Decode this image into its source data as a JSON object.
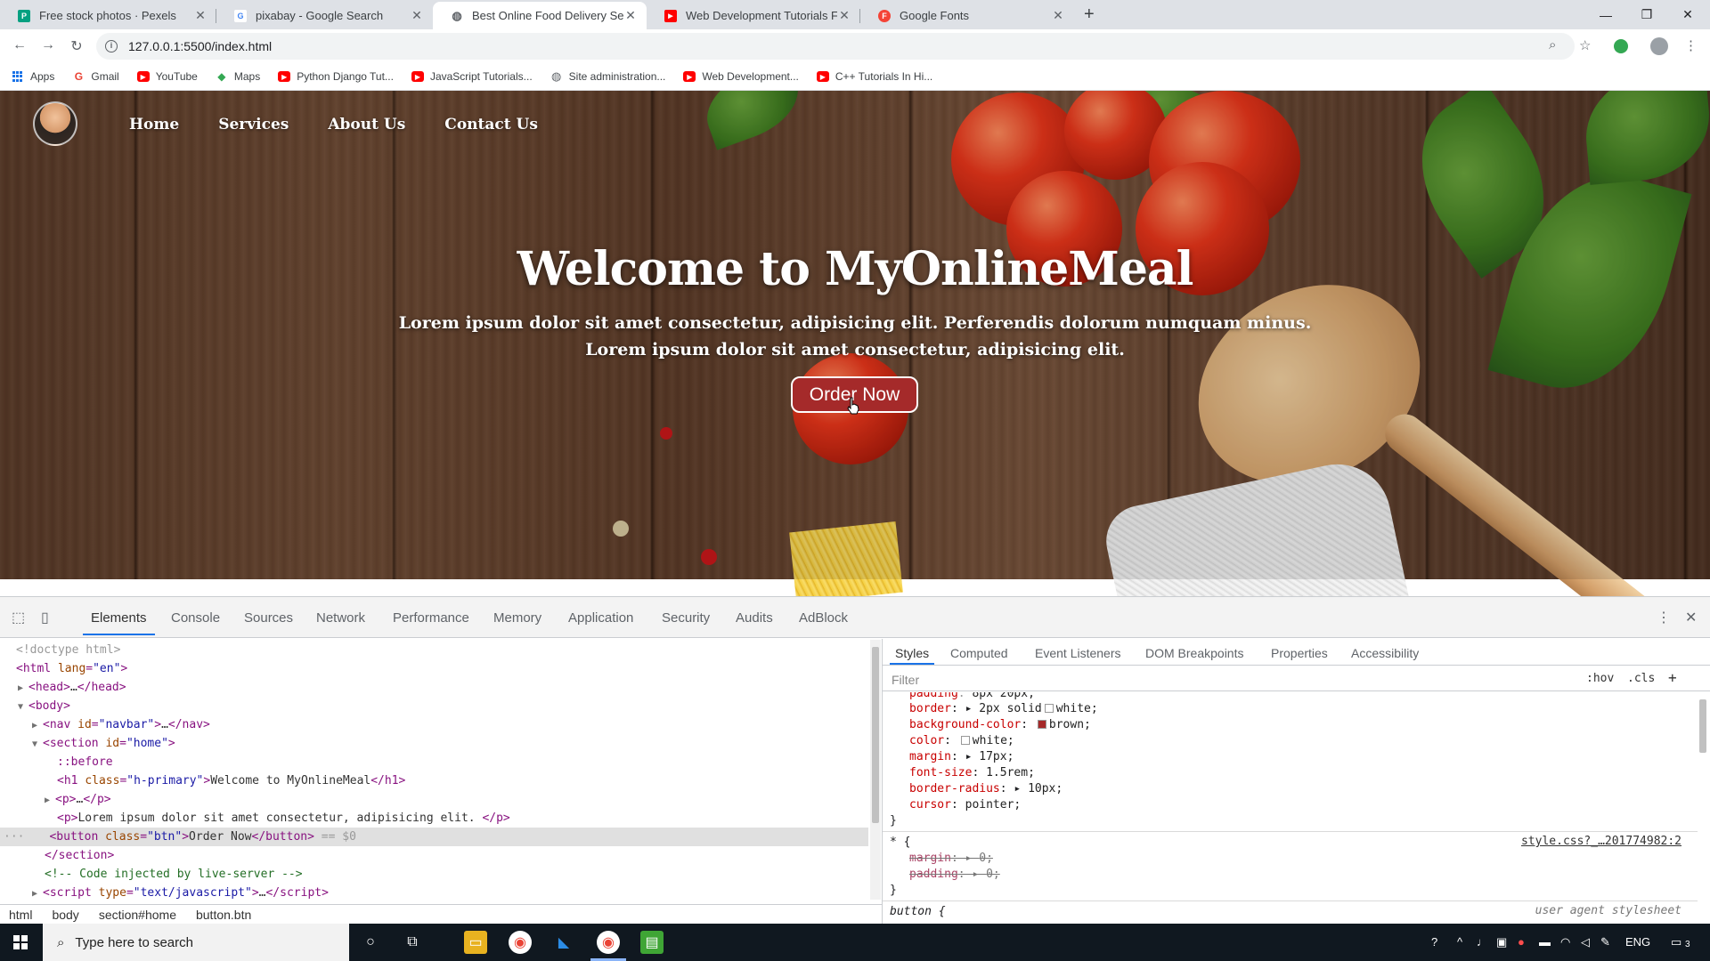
{
  "browser": {
    "tabs": [
      {
        "title": "Free stock photos · Pexels",
        "active": false,
        "favicon": "pexels-icon",
        "color": "#05a081",
        "glyph": "P"
      },
      {
        "title": "pixabay - Google Search",
        "active": false,
        "favicon": "google-icon",
        "color": "#ffffff",
        "glyph": "G"
      },
      {
        "title": "Best Online Food Delivery Servic",
        "active": true,
        "favicon": "globe-icon",
        "color": "#5f6368",
        "glyph": "◍"
      },
      {
        "title": "Web Development Tutorials For B",
        "active": false,
        "favicon": "youtube-icon",
        "color": "#ff0000",
        "glyph": "▶"
      },
      {
        "title": "Google Fonts",
        "active": false,
        "favicon": "google-fonts-icon",
        "color": "#f44336",
        "glyph": "F"
      }
    ],
    "url": "127.0.0.1:5500/index.html",
    "bookmarks": [
      {
        "label": "Apps",
        "icon": "apps-icon",
        "color": "#1a73e8"
      },
      {
        "label": "Gmail",
        "icon": "google-icon",
        "color": "#ea4335",
        "glyph": "G"
      },
      {
        "label": "YouTube",
        "icon": "youtube-icon",
        "color": "#ff0000",
        "glyph": "▶"
      },
      {
        "label": "Maps",
        "icon": "maps-icon",
        "color": "#34a853",
        "glyph": "◆"
      },
      {
        "label": "Python Django Tut...",
        "icon": "youtube-icon",
        "color": "#ff0000",
        "glyph": "▶"
      },
      {
        "label": "JavaScript Tutorials...",
        "icon": "youtube-icon",
        "color": "#ff0000",
        "glyph": "▶"
      },
      {
        "label": "Site administration...",
        "icon": "globe-icon",
        "color": "#5f6368",
        "glyph": "◍"
      },
      {
        "label": "Web Development...",
        "icon": "youtube-icon",
        "color": "#ff0000",
        "glyph": "▶"
      },
      {
        "label": "C++ Tutorials In Hi...",
        "icon": "youtube-icon",
        "color": "#ff0000",
        "glyph": "▶"
      }
    ]
  },
  "page": {
    "nav": [
      "Home",
      "Services",
      "About Us",
      "Contact Us"
    ],
    "heading": "Welcome to MyOnlineMeal",
    "para1": "Lorem ipsum dolor sit amet consectetur, adipisicing elit. Perferendis dolorum numquam minus.",
    "para2": "Lorem ipsum dolor sit amet consectetur, adipisicing elit.",
    "button": "Order Now",
    "button_color": "#a52a2a"
  },
  "devtools": {
    "tabs": [
      "Elements",
      "Console",
      "Sources",
      "Network",
      "Performance",
      "Memory",
      "Application",
      "Security",
      "Audits",
      "AdBlock"
    ],
    "active_tab": "Elements",
    "dom": {
      "doctype": "<!doctype html>",
      "html_open": "html",
      "lang_attr": "lang",
      "lang_val": "\"en\"",
      "head": "head",
      "body": "body",
      "nav_id": "\"navbar\"",
      "section_id": "\"home\"",
      "before": "::before",
      "h1_class": "\"h-primary\"",
      "h1_text": "Welcome to MyOnlineMeal",
      "p_text": "Lorem ipsum dolor sit amet consectetur, adipisicing elit.",
      "button_class": "\"btn\"",
      "button_text": "Order Now",
      "selected_marker": "== $0",
      "comment": "<!-- Code injected by live-server -->",
      "script_type": "\"text/javascript\""
    },
    "breadcrumbs": [
      "html",
      "body",
      "section#home",
      "button.btn"
    ],
    "styles_tabs": [
      "Styles",
      "Computed",
      "Event Listeners",
      "DOM Breakpoints",
      "Properties",
      "Accessibility"
    ],
    "filter_placeholder": "Filter",
    "hov": ":hov",
    "cls": ".cls",
    "css_rules": [
      {
        "prop": "padding",
        "value": "8px 20px;"
      },
      {
        "prop": "border",
        "value": "2px solid",
        "swatch": "#ffffff",
        "tail": "white;"
      },
      {
        "prop": "background-color",
        "value": "",
        "swatch": "#a52a2a",
        "tail": "brown;"
      },
      {
        "prop": "color",
        "value": "",
        "swatch": "#ffffff",
        "tail": "white;"
      },
      {
        "prop": "margin",
        "value": "17px;"
      },
      {
        "prop": "font-size",
        "value": "1.5rem;"
      },
      {
        "prop": "border-radius",
        "value": "10px;"
      },
      {
        "prop": "cursor",
        "value": "pointer;"
      }
    ],
    "universal_selector": "* {",
    "universal_source": "style.css?_…201774982:2",
    "struck": [
      {
        "prop": "margin",
        "value": "0;"
      },
      {
        "prop": "padding",
        "value": "0;"
      }
    ],
    "button_selector": "button {",
    "ua_label": "user agent stylesheet"
  },
  "taskbar": {
    "search_placeholder": "Type here to search",
    "lang": "ENG",
    "notif_count": "3"
  }
}
